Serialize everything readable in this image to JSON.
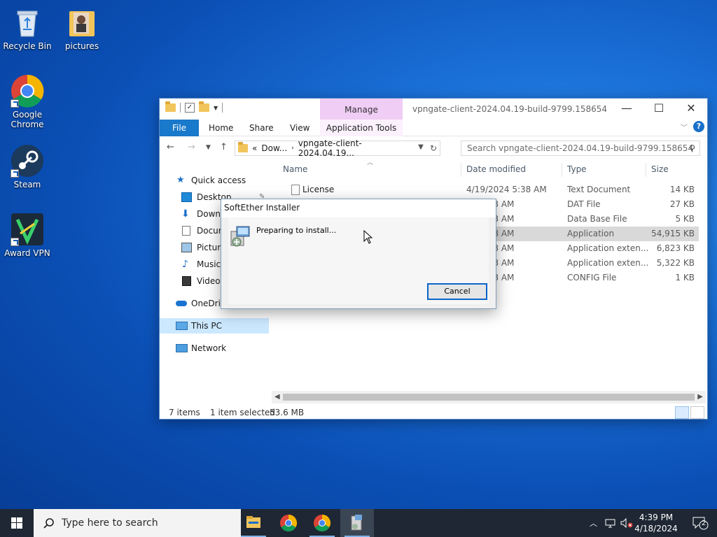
{
  "desktop": {
    "icons": [
      {
        "label": "Recycle Bin"
      },
      {
        "label": "pictures"
      },
      {
        "label": "Google Chrome"
      },
      {
        "label": "Steam"
      },
      {
        "label": "Award VPN"
      }
    ]
  },
  "explorer": {
    "title": "vpngate-client-2024.04.19-build-9799.158654",
    "context_tab": "Manage",
    "ribbon_tabs": [
      "File",
      "Home",
      "Share",
      "View",
      "Application Tools"
    ],
    "address": {
      "root": "«",
      "parent": "Dow...",
      "current": "vpngate-client-2024.04.19..."
    },
    "search_placeholder": "Search vpngate-client-2024.04.19-build-9799.158654",
    "nav": {
      "quick_access": "Quick access",
      "desktop": "Desktop",
      "downloads": "Downlo",
      "documents": "Docum",
      "pictures": "Picture",
      "music": "Music",
      "videos": "Videos",
      "onedrive": "OneDriv",
      "this_pc": "This PC",
      "network": "Network"
    },
    "columns": {
      "name": "Name",
      "date": "Date modified",
      "type": "Type",
      "size": "Size"
    },
    "files": [
      {
        "name": "License",
        "date": "4/19/2024 5:38 AM",
        "type": "Text Document",
        "size": "14 KB"
      },
      {
        "name": "",
        "date": "24 5:38 AM",
        "type": "DAT File",
        "size": "27 KB"
      },
      {
        "name": "",
        "date": "24 5:38 AM",
        "type": "Data Base File",
        "size": "5 KB"
      },
      {
        "name": "",
        "date": "24 5:38 AM",
        "type": "Application",
        "size": "54,915 KB"
      },
      {
        "name": "",
        "date": "24 5:38 AM",
        "type": "Application exten...",
        "size": "6,823 KB"
      },
      {
        "name": "",
        "date": "24 5:38 AM",
        "type": "Application exten...",
        "size": "5,322 KB"
      },
      {
        "name": "",
        "date": "24 5:38 AM",
        "type": "CONFIG File",
        "size": "1 KB"
      }
    ],
    "status": {
      "items": "7 items",
      "selected": "1 item selected",
      "size": "53.6 MB"
    }
  },
  "dialog": {
    "title": "SoftEther Installer",
    "message": "Preparing to install...",
    "cancel": "Cancel"
  },
  "taskbar": {
    "search_placeholder": "Type here to search",
    "time": "4:39 PM",
    "date": "4/18/2024",
    "notifications": "2"
  }
}
